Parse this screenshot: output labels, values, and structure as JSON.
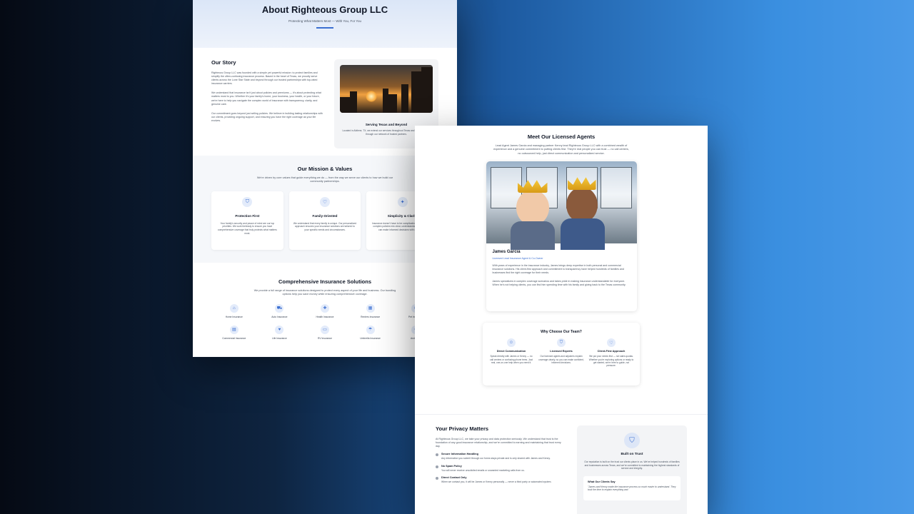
{
  "about": {
    "title": "About Righteous Group LLC",
    "tagline": "Protecting What Matters Most — With You, For You",
    "story": {
      "heading": "Our Story",
      "paragraphs": [
        "Righteous Group LLC was founded with a simple yet powerful mission: to protect families and simplify the often-confusing insurance process. Based in the heart of Texas, we proudly serve clients across the Lone Star State and beyond through our trusted partnerships with top-rated insurance carriers.",
        "We understand that insurance isn't just about policies and premiums — it's about protecting what matters most to you. Whether it's your family's home, your business, your health, or your future, we're here to help you navigate the complex world of insurance with transparency, clarity, and genuine care.",
        "Our commitment goes beyond just selling policies. We believe in building lasting relationships with our clients, providing ongoing support, and ensuring you have the right coverage as your life evolves."
      ],
      "card_title": "Serving Texas and Beyond",
      "card_text": "Located in Abilene, TX, we extend our services throughout Texas and multiple states through our network of trusted partners."
    },
    "mission": {
      "heading": "Our Mission & Values",
      "lead": "We're driven by core values that guide everything we do — from the way we serve our clients to how we build our community partnerships.",
      "values": [
        {
          "title": "Protection First",
          "text": "Your family's security and peace of mind are our top priorities. We work tirelessly to ensure you have comprehensive coverage that truly protects what matters most."
        },
        {
          "title": "Family-Oriented",
          "text": "We understand that every family is unique. Our personalized approach ensures your insurance solutions are tailored to your specific needs and circumstances."
        },
        {
          "title": "Simplicity & Clarity",
          "text": "Insurance doesn't have to be complicated. We break down complex policies into clear, understandable terms so you can make informed decisions with confidence."
        }
      ]
    },
    "solutions": {
      "heading": "Comprehensive Insurance Solutions",
      "lead": "We provide a full range of insurance solutions designed to protect every aspect of your life and business. Our bundling options help you save money while ensuring comprehensive coverage.",
      "items": [
        "Home Insurance",
        "Auto Insurance",
        "Health Insurance",
        "Renters Insurance",
        "Pet Insurance",
        "Commercial Insurance",
        "Life Insurance",
        "RV Insurance",
        "Umbrella Insurance",
        "And more"
      ]
    }
  },
  "agents": {
    "heading": "Meet Our Licensed Agents",
    "lead": "Lead Agent James Garcia and managing partner Kenny lead Righteous Group LLC with a combined wealth of experience and a genuine commitment to putting clients first. They're real people you can trust — no call centers, no outsourced help, just direct communication and personalized service.",
    "agent": {
      "name": "James Garcia",
      "role": "Licensed Lead Insurance Agent & Co-Owner",
      "bio1": "With years of experience in the insurance industry, James brings deep expertise in both personal and commercial insurance solutions. His client-first approach and commitment to transparency have helped hundreds of families and businesses find the right coverage for their needs.",
      "bio2": "James specializes in complex coverage scenarios and takes pride in making insurance understandable for everyone. When he's not helping clients, you can find him spending time with his family and giving back to the Texas community."
    },
    "why": {
      "heading": "Why Choose Our Team?",
      "cols": [
        {
          "title": "Direct Communication",
          "text": "Speak directly with James or Kenny — no call centers or confusing phone trees. Just real, one-on-one help when you need it."
        },
        {
          "title": "Licensed Experts",
          "text": "Our licensed agents and adjusters explain coverage clearly, so you can make confident, informed decisions."
        },
        {
          "title": "Client-First Approach",
          "text": "We put your needs first — not sales quotas. Whether you're exploring options or ready to get started, we're here to guide, not pressure."
        }
      ]
    },
    "privacy": {
      "heading": "Your Privacy Matters",
      "lead": "At Righteous Group LLC, we take your privacy and data protection seriously. We understand that trust is the foundation of any good insurance relationship, and we're committed to earning and maintaining that trust every day.",
      "items": [
        {
          "title": "Secure Information Handling",
          "text": "Any information you submit through our forms stays private and is only shared with James and Kenny."
        },
        {
          "title": "No Spam Policy",
          "text": "You will never receive unsolicited emails or unwanted marketing calls from us."
        },
        {
          "title": "Direct Contact Only",
          "text": "When we contact you, it will be James or Kenny personally — never a third party or automated system."
        }
      ],
      "trust_title": "Built on Trust",
      "trust_text": "Our reputation is built on the trust our clients place in us. We've helped hundreds of families and businesses across Texas, and we're committed to maintaining the highest standards of service and integrity.",
      "quote_title": "What Our Clients Say",
      "quote_text": "\"James and Kenny made the insurance process so much easier to understand. They took the time to explain everything and"
    }
  }
}
